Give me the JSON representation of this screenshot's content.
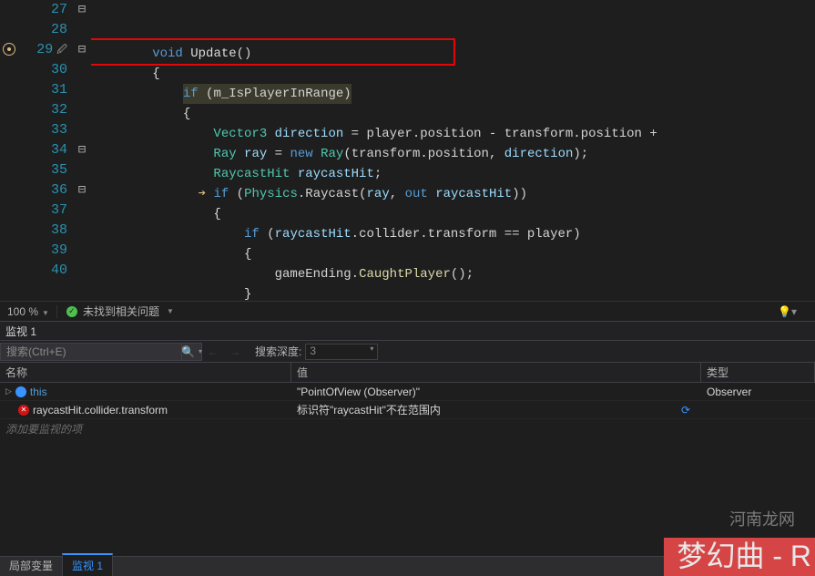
{
  "gutter_start": 27,
  "code_lines": [
    {
      "n": 27,
      "fold": "⊟",
      "html": "        <span class='kw'>void</span> <span class='id'>Update</span>()",
      "hl": false,
      "arrow": ""
    },
    {
      "n": 28,
      "fold": "",
      "html": "        <span class='brace'>{</span>",
      "hl": false,
      "arrow": ""
    },
    {
      "n": 29,
      "fold": "⊟",
      "html": "            <span class='kw'>if</span> (m_IsPlayerInRange)",
      "hl": true,
      "arrow": "",
      "bp": true,
      "insight": true
    },
    {
      "n": 30,
      "fold": "",
      "html": "            <span class='brace'>{</span>",
      "hl": false,
      "arrow": ""
    },
    {
      "n": 31,
      "fold": "",
      "html": "                <span class='type'>Vector3</span> <span class='param'>direction</span> = player.position - transform.position +",
      "hl": false,
      "arrow": ""
    },
    {
      "n": 32,
      "fold": "",
      "html": "                <span class='type'>Ray</span> <span class='param'>ray</span> = <span class='kw'>new</span> <span class='type'>Ray</span>(transform.position, <span class='param'>direction</span>);",
      "hl": false,
      "arrow": ""
    },
    {
      "n": 33,
      "fold": "",
      "html": "                <span class='type'>RaycastHit</span> <span class='param'>raycastHit</span>;",
      "hl": false,
      "arrow": ""
    },
    {
      "n": 34,
      "fold": "⊟",
      "html": "                <span class='kw'>if</span> (<span class='type'>Physics</span>.Raycast(<span class='param'>ray</span>, <span class='kw'>out</span> <span class='param'>raycastHit</span>))",
      "hl": false,
      "arrow": "➔"
    },
    {
      "n": 35,
      "fold": "",
      "html": "                <span class='brace'>{</span>",
      "hl": false,
      "arrow": ""
    },
    {
      "n": 36,
      "fold": "⊟",
      "html": "                    <span class='kw'>if</span> (<span class='param'>raycastHit</span>.collider.transform == player)",
      "hl": false,
      "arrow": ""
    },
    {
      "n": 37,
      "fold": "",
      "html": "                    <span class='brace'>{</span>",
      "hl": false,
      "arrow": ""
    },
    {
      "n": 38,
      "fold": "",
      "html": "                        gameEnding.<span class='func'>CaughtPlayer</span>();",
      "hl": false,
      "arrow": ""
    },
    {
      "n": 39,
      "fold": "",
      "html": "                    <span class='brace'>}</span>",
      "hl": false,
      "arrow": ""
    },
    {
      "n": 40,
      "fold": "",
      "html": "                <span class='brace'>}</span>",
      "hl": false,
      "arrow": ""
    }
  ],
  "status": {
    "zoom": "100 %",
    "issues": "未找到相关问题"
  },
  "watch": {
    "title": "监视 1",
    "search_placeholder": "搜索(Ctrl+E)",
    "depth_label": "搜索深度:",
    "depth_value": "3",
    "columns": {
      "name": "名称",
      "value": "值",
      "type": "类型"
    },
    "rows": [
      {
        "icon": "this",
        "name": "this",
        "value": "\"PointOfView (Observer)\"",
        "type": "Observer",
        "expand": true
      },
      {
        "icon": "error",
        "name": "raycastHit.collider.transform",
        "value": "标识符\"raycastHit\"不在范围内",
        "type": "",
        "refresh": true
      }
    ],
    "placeholder": "添加要监视的项"
  },
  "tabs": {
    "locals": "局部变量",
    "watch": "监视 1"
  },
  "watermark1": "河南龙网",
  "watermark2": "梦幻曲 - R"
}
